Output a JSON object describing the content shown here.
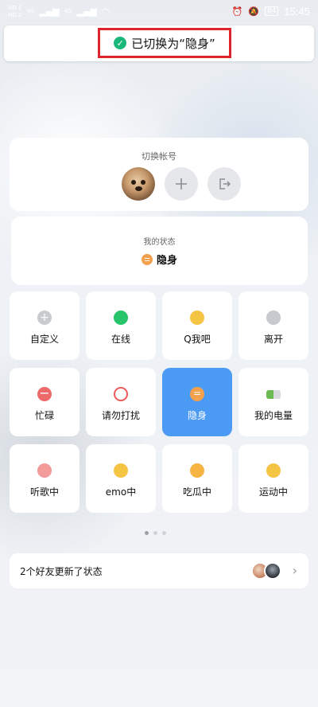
{
  "status_bar": {
    "sim1": "HD 1",
    "sim2": "HD 2",
    "net1": "4G",
    "net2": "4G",
    "battery": "84",
    "time": "15:45"
  },
  "toast": {
    "text": "已切换为“隐身”"
  },
  "account": {
    "title": "切换帐号"
  },
  "my_status": {
    "title": "我的状态",
    "value": "隐身"
  },
  "tiles": [
    {
      "label": "自定义",
      "icon": "plus-icon",
      "color": "#c8cacd"
    },
    {
      "label": "在线",
      "icon": "online-dot-icon",
      "color": "#27c46a"
    },
    {
      "label": "Q我吧",
      "icon": "smile-emoji-icon",
      "color": "#f6c445"
    },
    {
      "label": "离开",
      "icon": "clock-icon",
      "color": "#b3b7bd"
    },
    {
      "label": "忙碌",
      "icon": "minus-icon",
      "color": "#ee6a6a"
    },
    {
      "label": "请勿打扰",
      "icon": "no-entry-icon",
      "color": "#ee5a5a"
    },
    {
      "label": "隐身",
      "icon": "equals-icon",
      "color": "#f3a14d"
    },
    {
      "label": "我的电量",
      "icon": "battery-icon",
      "color": "#6bbb52"
    },
    {
      "label": "听歌中",
      "icon": "headphones-emoji-icon",
      "color": "#f39a9a"
    },
    {
      "label": "emo中",
      "icon": "emo-face-icon",
      "color": "#f6c445"
    },
    {
      "label": "吃瓜中",
      "icon": "eating-emoji-icon",
      "color": "#f6b445"
    },
    {
      "label": "运动中",
      "icon": "sport-emoji-icon",
      "color": "#f6c445"
    }
  ],
  "friends": {
    "text": "2个好友更新了状态"
  }
}
